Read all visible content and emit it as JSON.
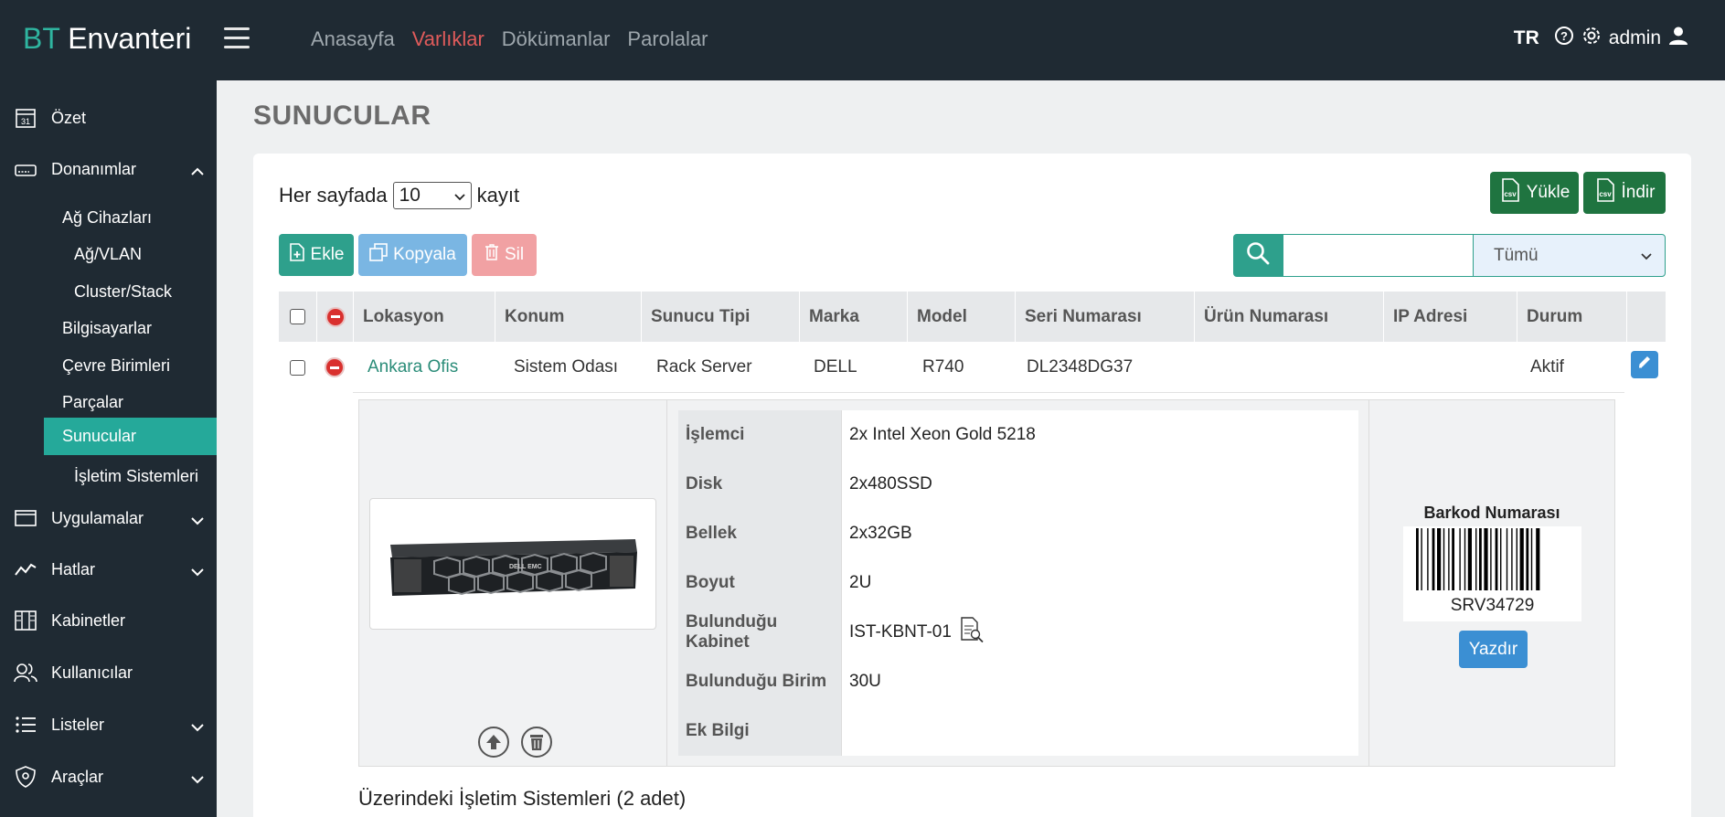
{
  "brand": {
    "prefix": "BT",
    "name": "Envanteri"
  },
  "topnav": [
    {
      "label": "Anasayfa"
    },
    {
      "label": "Varlıklar"
    },
    {
      "label": "Dökümanlar"
    },
    {
      "label": "Parolalar"
    }
  ],
  "user": {
    "lang": "TR",
    "name": "admin"
  },
  "sidebar": {
    "ozet": "Özet",
    "donanimlar": "Donanımlar",
    "ag_cihazlari": "Ağ Cihazları",
    "ag_vlan": "Ağ/VLAN",
    "cluster": "Cluster/Stack",
    "bilgisayarlar": "Bilgisayarlar",
    "cevre": "Çevre Birimleri",
    "parcalar": "Parçalar",
    "sunucular": "Sunucular",
    "isletim": "İşletim Sistemleri",
    "uygulamalar": "Uygulamalar",
    "hatlar": "Hatlar",
    "kabinetler": "Kabinetler",
    "kullanicilar": "Kullanıcılar",
    "listeler": "Listeler",
    "araclar": "Araçlar"
  },
  "page": {
    "title": "SUNUCULAR"
  },
  "toolbar": {
    "perpage_prefix": "Her sayfada",
    "perpage_value": "10",
    "perpage_suffix": "kayıt",
    "add": "Ekle",
    "copy": "Kopyala",
    "delete": "Sil",
    "upload": "Yükle",
    "download": "İndir",
    "csv": "csv",
    "filter": "Tümü"
  },
  "table": {
    "headers": [
      "Lokasyon",
      "Konum",
      "Sunucu Tipi",
      "Marka",
      "Model",
      "Seri Numarası",
      "Ürün Numarası",
      "IP Adresi",
      "Durum"
    ],
    "row": {
      "lokasyon": "Ankara Ofis",
      "konum": "Sistem Odası",
      "tip": "Rack Server",
      "marka": "DELL",
      "model": "R740",
      "seri": "DL2348DG37",
      "urun": "",
      "ip": "",
      "durum": "Aktif"
    }
  },
  "details": {
    "rows": [
      {
        "key": "İşlemci",
        "value": "2x Intel Xeon Gold 5218"
      },
      {
        "key": "Disk",
        "value": "2x480SSD"
      },
      {
        "key": "Bellek",
        "value": "2x32GB"
      },
      {
        "key": "Boyut",
        "value": "2U"
      },
      {
        "key": "Bulunduğu Kabinet",
        "value": "IST-KBNT-01"
      },
      {
        "key": "Bulunduğu Birim",
        "value": "30U"
      },
      {
        "key": "Ek Bilgi",
        "value": ""
      }
    ],
    "server_label": "DELL EMC",
    "barcode_title": "Barkod Numarası",
    "barcode_number": "SRV34729",
    "print": "Yazdır"
  },
  "os_section": {
    "title": "Üzerindeki İşletim Sistemleri (2 adet)"
  },
  "colors": {
    "accent": "#2ea08c",
    "active_nav": "#e05b5b",
    "sidebar_bg": "#1f2a33"
  }
}
